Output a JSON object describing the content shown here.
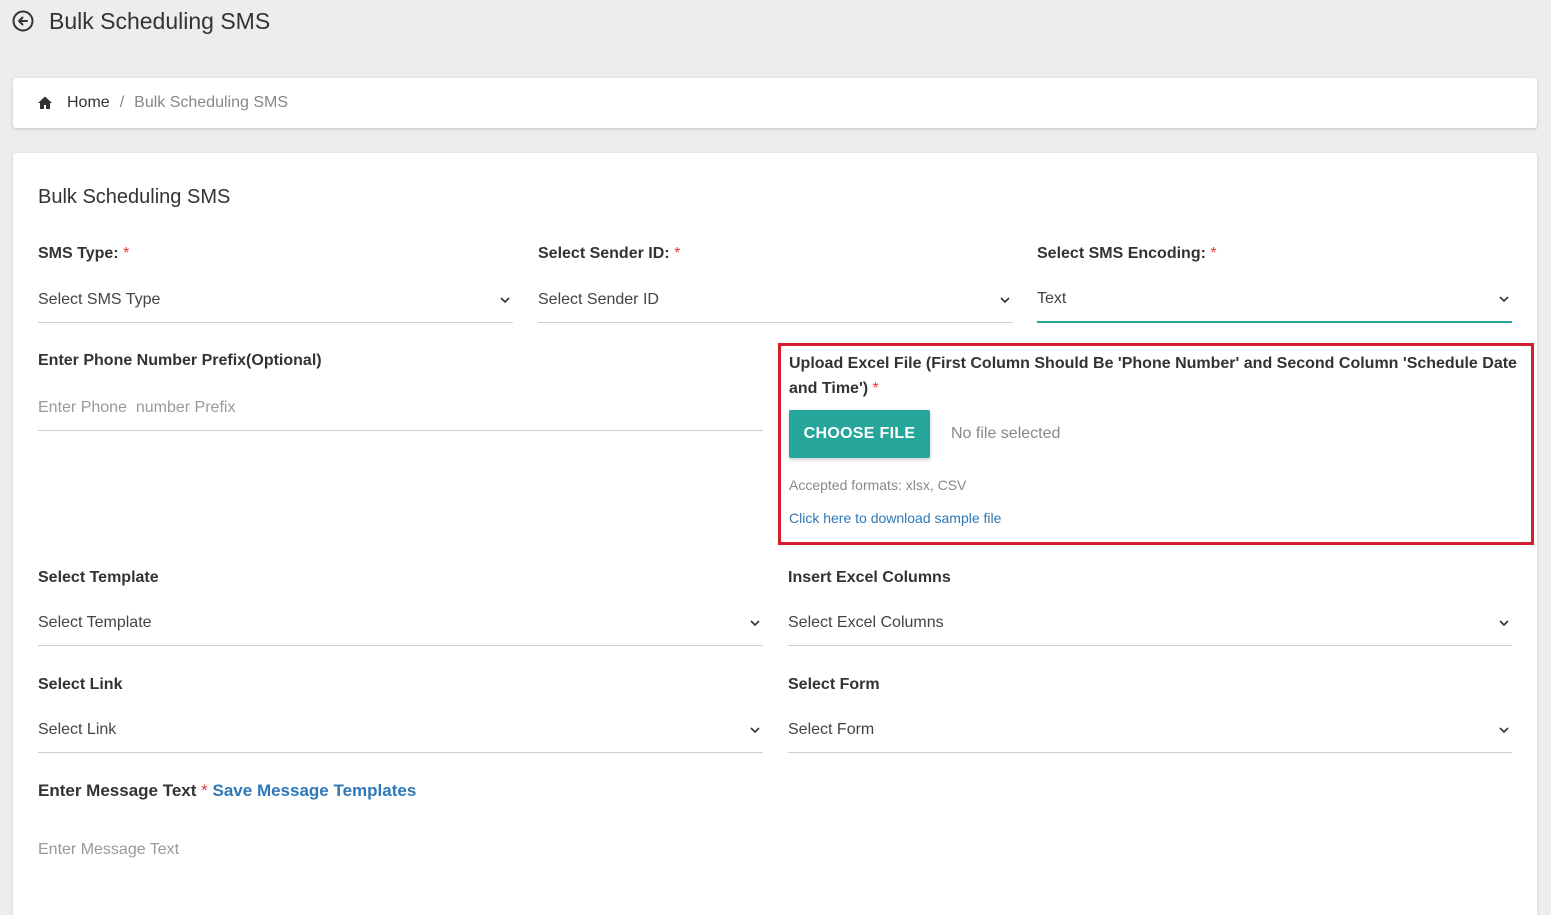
{
  "page": {
    "title": "Bulk Scheduling SMS"
  },
  "breadcrumb": {
    "home": "Home",
    "separator": "/",
    "current": "Bulk Scheduling SMS"
  },
  "card": {
    "title": "Bulk Scheduling SMS"
  },
  "form": {
    "sms_type": {
      "label": "SMS Type:",
      "required": "*",
      "value": "Select SMS Type"
    },
    "sender_id": {
      "label": "Select Sender ID:",
      "required": "*",
      "value": "Select Sender ID"
    },
    "encoding": {
      "label": "Select SMS Encoding:",
      "required": "*",
      "value": "Text"
    },
    "prefix": {
      "label": "Enter Phone Number Prefix(Optional)",
      "placeholder": "Enter Phone  number Prefix"
    },
    "upload": {
      "label": "Upload Excel File (First Column Should Be 'Phone Number' and Second Column 'Schedule Date and Time')",
      "required": "*",
      "button": "CHOOSE FILE",
      "status": "No file selected",
      "formats": "Accepted formats: xlsx, CSV",
      "sample_link": "Click here to download sample file"
    },
    "template": {
      "label": "Select Template",
      "value": "Select Template"
    },
    "excel_columns": {
      "label": "Insert Excel Columns",
      "value": "Select Excel Columns"
    },
    "link": {
      "label": "Select Link",
      "value": "Select Link"
    },
    "form_select": {
      "label": "Select Form",
      "value": "Select Form"
    },
    "message": {
      "label": "Enter Message Text",
      "required": "*",
      "save_link": "Save Message Templates",
      "placeholder": "Enter Message Text"
    }
  },
  "colors": {
    "accent": "#26a69a",
    "required": "#e03b3b",
    "link": "#2f78b8",
    "highlight_border": "#d2202f"
  },
  "icons": {
    "back": "arrow-left-circle-icon",
    "home": "home-icon",
    "dropdown": "chevron-down-icon"
  }
}
